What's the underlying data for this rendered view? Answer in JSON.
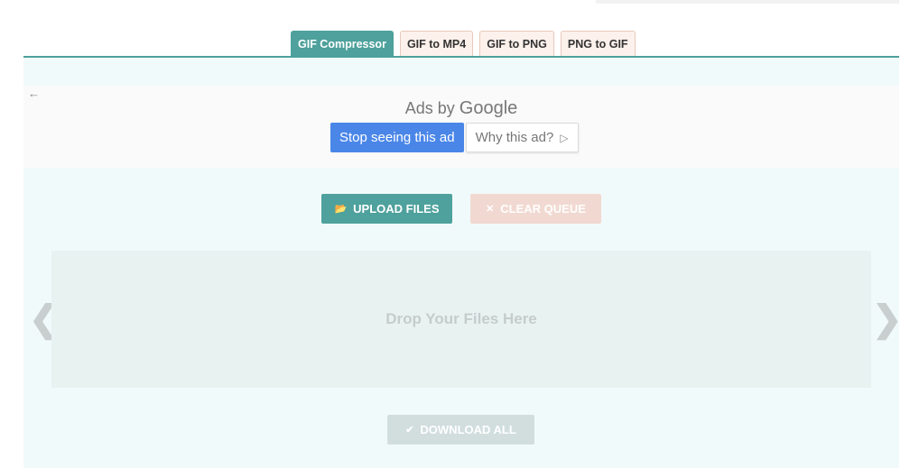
{
  "tabs": [
    {
      "label": "GIF Compressor",
      "active": true
    },
    {
      "label": "GIF to MP4",
      "active": false
    },
    {
      "label": "GIF to PNG",
      "active": false
    },
    {
      "label": "PNG to GIF",
      "active": false
    }
  ],
  "ad": {
    "back_icon": "←",
    "ads_by": "Ads by",
    "brand": "Google",
    "stop_label": "Stop seeing this ad",
    "why_label": "Why this ad?",
    "why_icon": "▷"
  },
  "actions": {
    "upload_icon": "📂",
    "upload_label": "UPLOAD FILES",
    "clear_icon": "✕",
    "clear_label": "CLEAR QUEUE",
    "download_icon": "✔",
    "download_label": "DOWNLOAD ALL"
  },
  "dropzone": {
    "label": "Drop Your Files Here"
  },
  "carousel": {
    "prev": "❮",
    "next": "❯"
  },
  "colors": {
    "accent": "#4ea19c",
    "ad_blue": "#4a86e8",
    "panel_bg": "#f1fafa"
  }
}
